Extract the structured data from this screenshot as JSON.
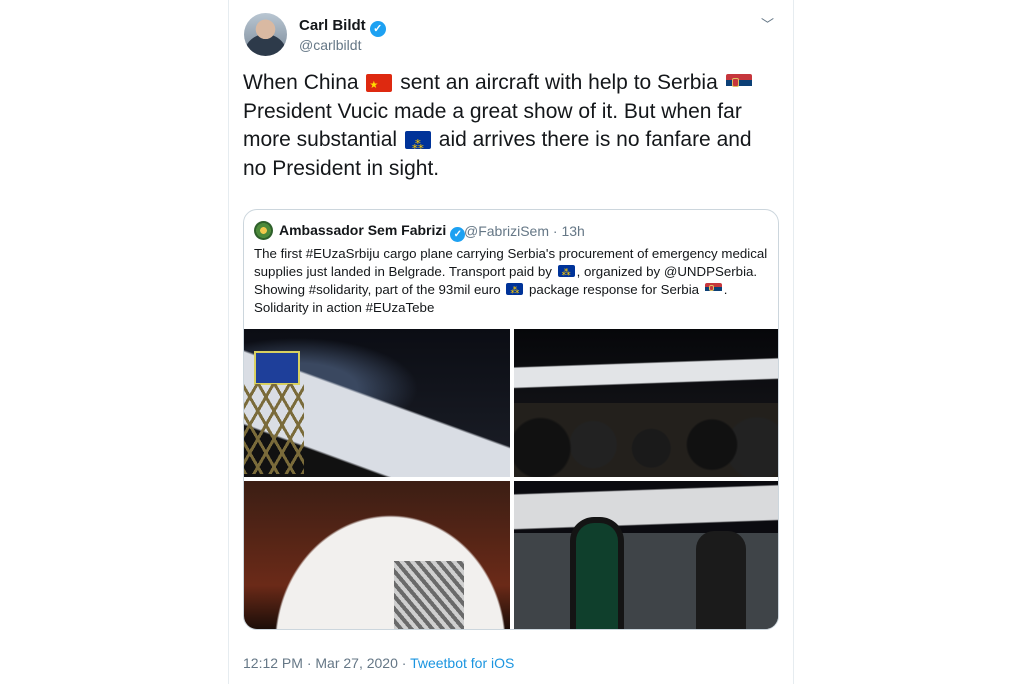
{
  "author": {
    "name": "Carl Bildt",
    "handle": "@carlbildt"
  },
  "tweet": {
    "segments": [
      "When China",
      "sent an aircraft with help to Serbia",
      "President Vucic made a great show of it. But when far more substantial",
      "aid arrives there is no fanfare and no President in sight."
    ],
    "flags": [
      "china-flag",
      "serbia-flag",
      "eu-flag"
    ]
  },
  "quoted": {
    "name": "Ambassador Sem Fabrizi",
    "handle": "@FabriziSem",
    "time": "· 13h",
    "segments": [
      "The first #EUzaSrbiju cargo plane carrying Serbia's procurement of emergency medical supplies just landed in Belgrade. Transport paid by",
      ", organized by @UNDPSerbia. Showing #solidarity, part of the 93mil euro",
      "package response for Serbia",
      ". Solidarity in action #EUzaTebe"
    ],
    "photos": [
      "cargo-plane-loading-photo",
      "press-gathering-photo",
      "transavia-plane-nose-photo",
      "officials-on-tarmac-photo"
    ]
  },
  "meta": {
    "timestamp": "12:12 PM · Mar 27, 2020 ·",
    "app": "Tweetbot for iOS"
  },
  "colors": {
    "verified": "#1da1f2",
    "link": "#1b95e0",
    "secondary_text": "#657786"
  }
}
